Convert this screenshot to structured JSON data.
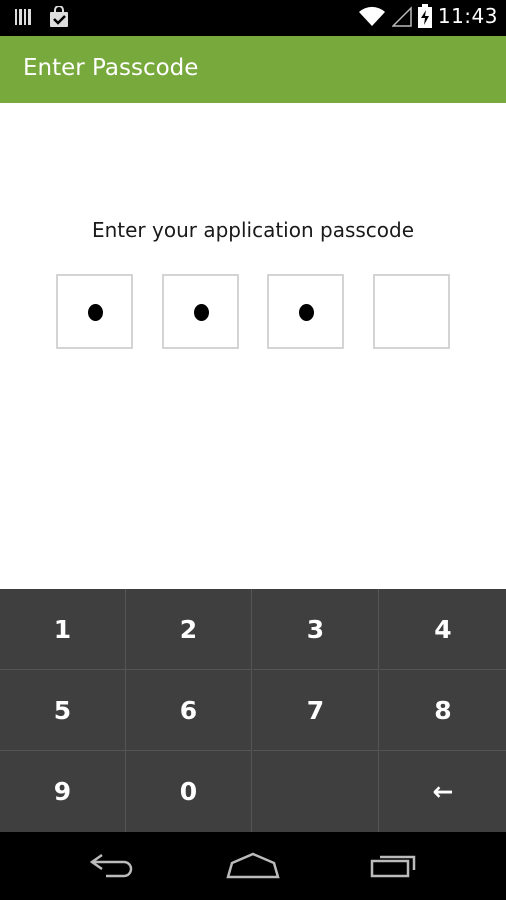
{
  "status_bar": {
    "time": "11:43",
    "icons": [
      "barcode-icon",
      "shopping-bag-icon",
      "wifi-icon",
      "signal-icon",
      "battery-charging-icon"
    ]
  },
  "action_bar": {
    "title": "Enter Passcode"
  },
  "prompt": "Enter your application passcode",
  "pin": {
    "length": 4,
    "filled": 3
  },
  "keypad": {
    "keys": [
      "1",
      "2",
      "3",
      "4",
      "5",
      "6",
      "7",
      "8",
      "9",
      "0",
      "",
      "←"
    ]
  },
  "nav_bar": {
    "buttons": [
      "back-icon",
      "home-icon",
      "recent-apps-icon"
    ]
  },
  "colors": {
    "action_bar": "#77a93c",
    "keypad_bg": "#3f3f3f",
    "status_bar": "#000000",
    "pin_border": "#d4d4d4"
  }
}
